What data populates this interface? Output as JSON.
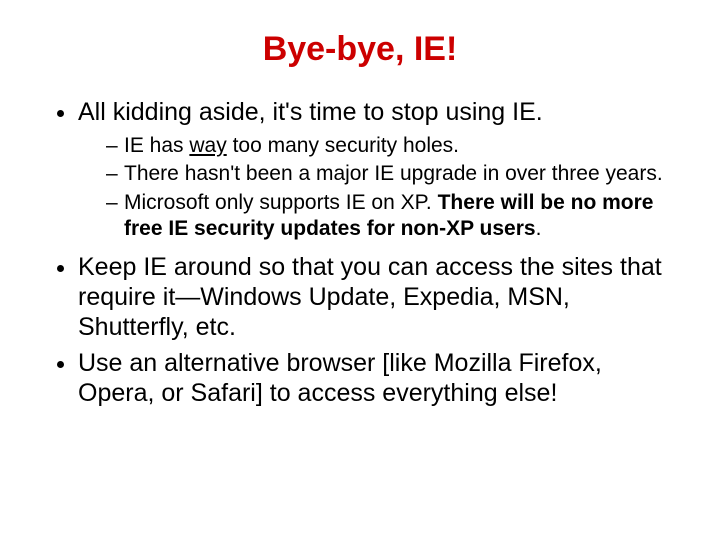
{
  "title": "Bye-bye, IE!",
  "bullets": {
    "b1": "All kidding aside, it's time to stop using IE.",
    "b1_sub": {
      "s1a": "IE has ",
      "s1b": "way",
      "s1c": " too many security holes.",
      "s2": "There hasn't been a major IE upgrade in over three years.",
      "s3a": "Microsoft only supports IE on XP.  ",
      "s3b": "There will be no more free IE security updates for non-XP users",
      "s3c": "."
    },
    "b2": "Keep IE around so that you can access the sites that require it—Windows Update, Expedia, MSN, Shutterfly, etc.",
    "b3": "Use an alternative browser [like Mozilla Firefox, Opera, or Safari] to access everything else!"
  }
}
